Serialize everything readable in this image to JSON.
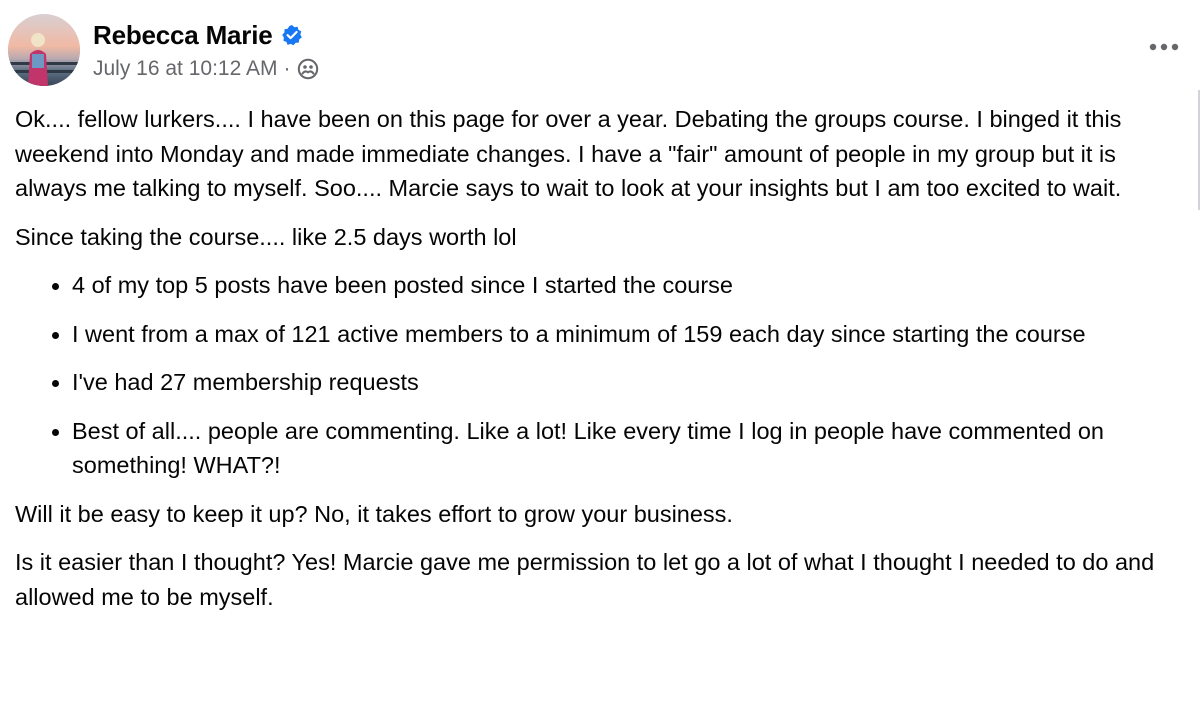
{
  "post": {
    "author": "Rebecca Marie",
    "timestamp": "July 16 at 10:12 AM",
    "separator": "·",
    "verified_icon": "verified-badge-icon",
    "audience_icon": "group-audience-icon",
    "more_icon": "more-options-icon",
    "colors": {
      "verified": "#1877f2",
      "secondary_text": "#65676b",
      "primary_text": "#050505"
    },
    "paragraphs_top": [
      "Ok.... fellow lurkers.... I have been on this page for over a year. Debating the groups course. I binged it this weekend into Monday and made immediate changes. I have a \"fair\" amount of people in my group but it is always me talking to myself. Soo.... Marcie says to wait to look at your insights but I am too excited to wait.",
      "Since taking the course.... like 2.5 days worth lol"
    ],
    "bullets": [
      "4 of my top 5 posts have been posted since I started the course",
      "I went from a max of 121 active members to a minimum of 159 each day since starting the course",
      "I've had 27 membership requests",
      "Best of all.... people are commenting. Like a lot! Like every time I log in people have commented on something! WHAT?!"
    ],
    "paragraphs_bottom": [
      "Will it be easy to keep it up? No, it takes effort to grow your business.",
      "Is it easier than I thought? Yes! Marcie gave me permission to let go a lot of what I thought I needed to do and allowed me to be myself."
    ]
  }
}
